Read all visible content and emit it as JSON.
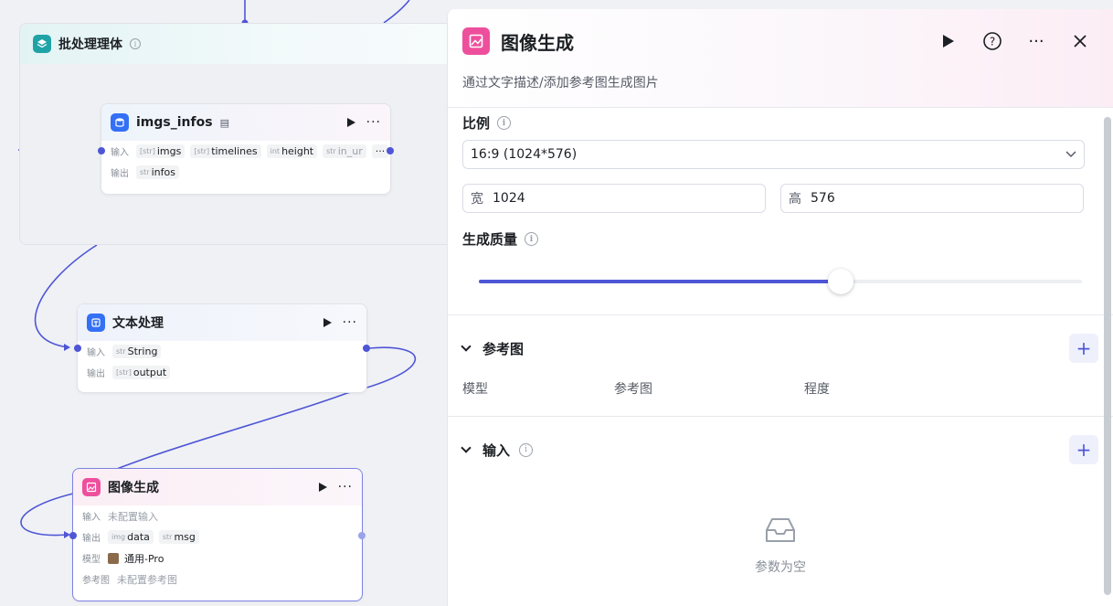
{
  "batch_group": {
    "title": "批处理理体"
  },
  "node_imgs": {
    "title": "imgs_infos",
    "input_label": "输入",
    "output_label": "输出",
    "inputs": [
      {
        "type": "[str]",
        "name": "imgs"
      },
      {
        "type": "[str]",
        "name": "timelines"
      },
      {
        "type": "int",
        "name": "height"
      },
      {
        "type": "str",
        "name": "in_ur"
      }
    ],
    "more": "···",
    "outputs": [
      {
        "type": "str",
        "name": "infos"
      }
    ]
  },
  "node_text": {
    "title": "文本处理",
    "input_label": "输入",
    "output_label": "输出",
    "inputs": [
      {
        "type": "str",
        "name": "String"
      }
    ],
    "outputs": [
      {
        "type": "[str]",
        "name": "output"
      }
    ]
  },
  "node_image": {
    "title": "图像生成",
    "input_label": "输入",
    "input_value": "未配置输入",
    "output_label": "输出",
    "outputs": [
      {
        "type": "img",
        "name": "data"
      },
      {
        "type": "str",
        "name": "msg"
      }
    ],
    "model_label": "模型",
    "model_value": "通用-Pro",
    "ref_label": "参考图",
    "ref_value": "未配置参考图"
  },
  "panel": {
    "title": "图像生成",
    "description": "通过文字描述/添加参考图生成图片",
    "ratio_label": "比例",
    "ratio_value": "16:9 (1024*576)",
    "width_label": "宽",
    "width_value": "1024",
    "height_label": "高",
    "height_value": "576",
    "quality_label": "生成质量",
    "quality_fraction": 0.6,
    "ref_section": "参考图",
    "ref_columns": [
      "模型",
      "参考图",
      "程度"
    ],
    "input_section": "输入",
    "empty_text": "参数为空"
  },
  "colors": {
    "accent": "#4e56d6",
    "brand_pink": "#ee4f9d",
    "teal": "#1fa3a6",
    "blue": "#3470f5"
  }
}
